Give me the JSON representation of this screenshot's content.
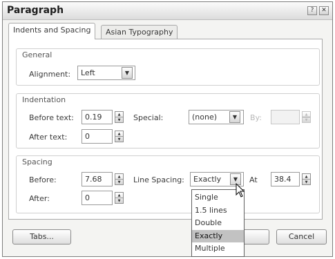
{
  "dialog": {
    "title": "Paragraph",
    "help_glyph": "?",
    "close_glyph": "✕"
  },
  "tabs": [
    {
      "label": "Indents and Spacing",
      "active": true
    },
    {
      "label": "Asian Typography",
      "active": false
    }
  ],
  "general": {
    "title": "General",
    "alignment_label": "Alignment:",
    "alignment_value": "Left"
  },
  "indentation": {
    "title": "Indentation",
    "before_text_label": "Before text:",
    "before_text_value": "0.19",
    "after_text_label": "After text:",
    "after_text_value": "0",
    "special_label": "Special:",
    "special_value": "(none)",
    "by_label": "By:",
    "by_value": ""
  },
  "spacing": {
    "title": "Spacing",
    "before_label": "Before:",
    "before_value": "7.68",
    "after_label": "After:",
    "after_value": "0",
    "line_spacing_label": "Line Spacing:",
    "line_spacing_value": "Exactly",
    "at_label": "At",
    "at_value": "38.4"
  },
  "line_spacing_options": [
    {
      "label": "Single",
      "selected": false
    },
    {
      "label": "1.5 lines",
      "selected": false
    },
    {
      "label": "Double",
      "selected": false
    },
    {
      "label": "Exactly",
      "selected": true
    },
    {
      "label": "Multiple",
      "selected": false
    }
  ],
  "buttons": {
    "tabs_label": "Tabs...",
    "cancel_label": "Cancel"
  },
  "glyphs": {
    "dropdown": "▼",
    "spin_up": "▲",
    "spin_down": "▼"
  }
}
